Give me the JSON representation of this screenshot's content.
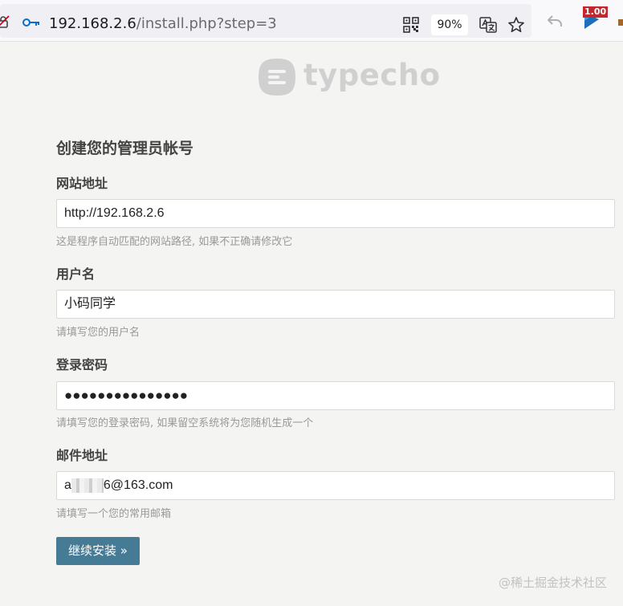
{
  "browser": {
    "url_host": "192.168.2.6",
    "url_path": "/install.php?step=3",
    "zoom": "90%",
    "extension_badge": "1.00"
  },
  "logo": {
    "text": "typecho"
  },
  "form": {
    "title": "创建您的管理员帐号",
    "site_url": {
      "label": "网站地址",
      "value": "http://192.168.2.6",
      "hint": "这是程序自动匹配的网站路径, 如果不正确请修改它"
    },
    "username": {
      "label": "用户名",
      "value": "小码同学",
      "hint": "请填写您的用户名"
    },
    "password": {
      "label": "登录密码",
      "value": "●●●●●●●●●●●●●●●",
      "hint": "请填写您的登录密码, 如果留空系统将为您随机生成一个"
    },
    "email": {
      "label": "邮件地址",
      "value_prefix": "a",
      "value_suffix": "6@163.com",
      "hint": "请填写一个您的常用邮箱"
    },
    "submit_label": "继续安装 »"
  },
  "watermark": "@稀土掘金技术社区",
  "colors": {
    "button": "#467b96",
    "background": "#f4f4f2",
    "logo": "#d0d0d0"
  }
}
